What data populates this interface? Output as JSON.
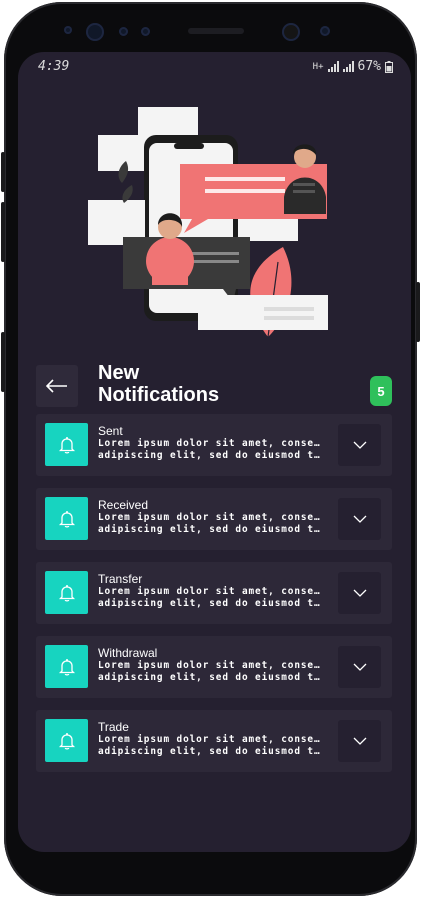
{
  "status_bar": {
    "time": "4:39",
    "network": "H+",
    "battery": "67%"
  },
  "header": {
    "title_line1": "New",
    "title_line2": "Notifications",
    "badge_count": "5",
    "back_icon": "arrow-left-icon"
  },
  "notifications": [
    {
      "title": "Sent",
      "line1": "Lorem ipsum dolor sit amet, consectetur",
      "line2": "adipiscing elit, sed do eiusmod tempor incididunt"
    },
    {
      "title": "Received",
      "line1": "Lorem ipsum dolor sit amet, consectetur",
      "line2": "adipiscing elit, sed do eiusmod tempor incididunt"
    },
    {
      "title": "Transfer",
      "line1": "Lorem ipsum dolor sit amet, consectetur",
      "line2": "adipiscing elit, sed do eiusmod tempor incididunt"
    },
    {
      "title": "Withdrawal",
      "line1": "Lorem ipsum dolor sit amet, consectetur",
      "line2": "adipiscing elit, sed do eiusmod tempor incididunt"
    },
    {
      "title": "Trade",
      "line1": "Lorem ipsum dolor sit amet, consectetur",
      "line2": "adipiscing elit, sed do eiusmod tempor incididunt"
    }
  ],
  "colors": {
    "screen_bg": "#252030",
    "card_bg": "#2d2838",
    "icon_bg": "#17d4c0",
    "badge_bg": "#2fc05b",
    "accent_pink": "#f07474"
  }
}
